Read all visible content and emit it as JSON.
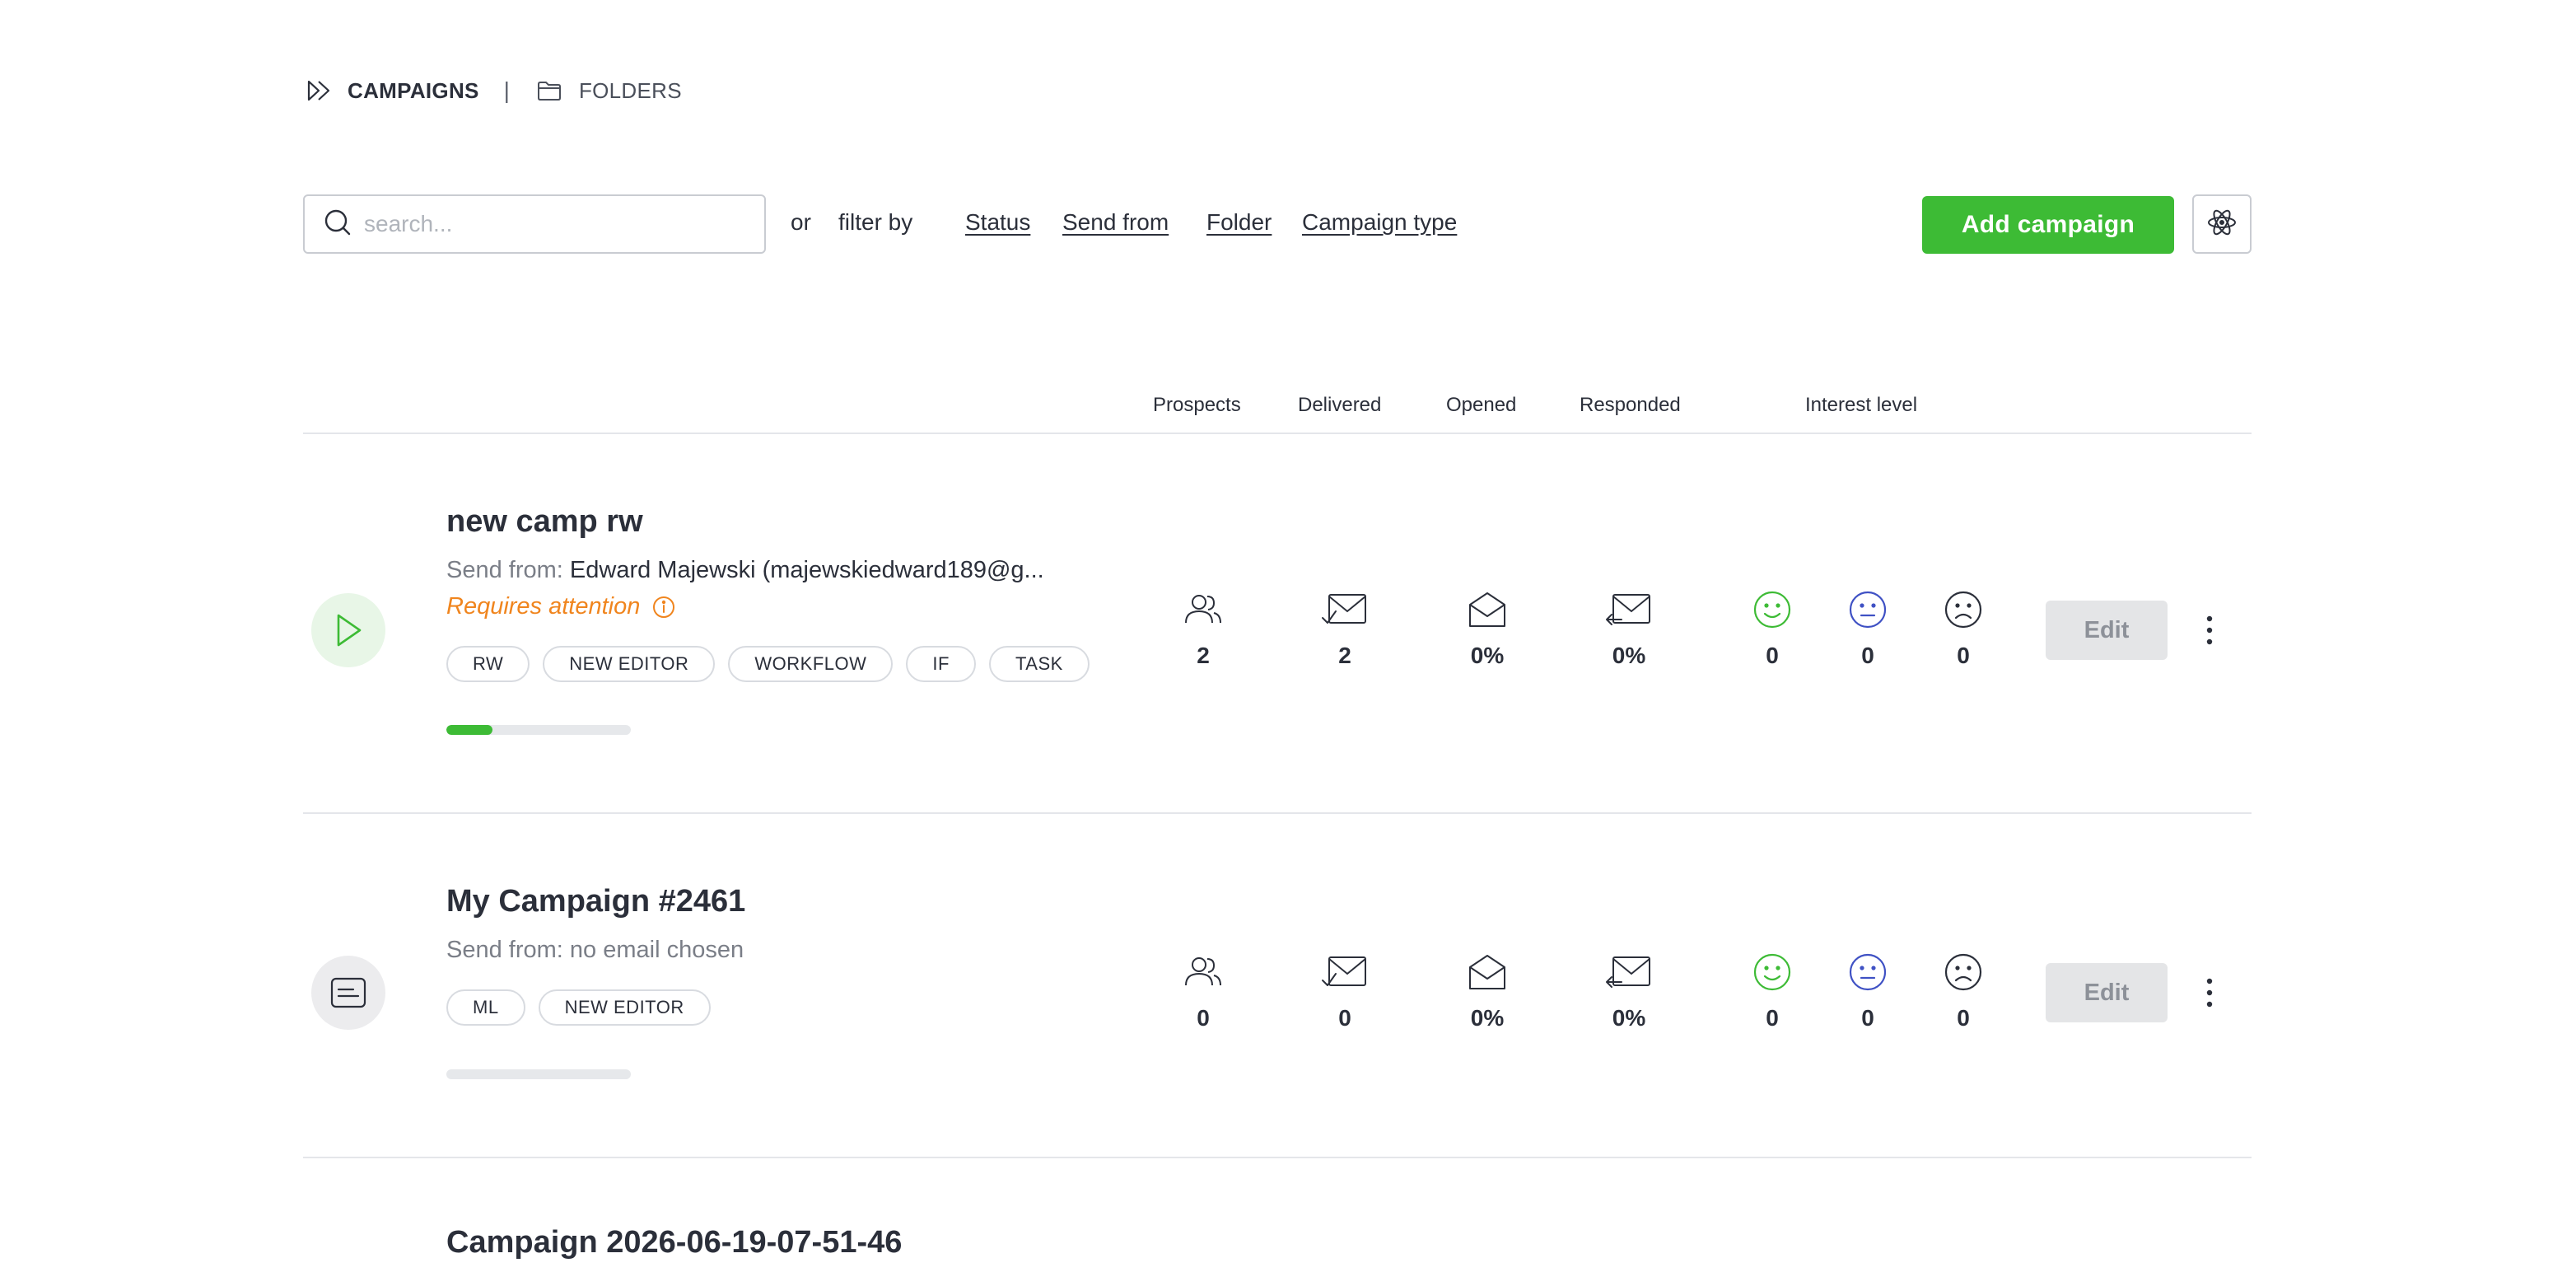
{
  "breadcrumb": {
    "campaigns": "CAMPAIGNS",
    "separator": "|",
    "folders": "FOLDERS"
  },
  "toolbar": {
    "search_placeholder": "search...",
    "or": "or",
    "filter_by": "filter by",
    "filters": [
      "Status",
      "Send from",
      "Folder",
      "Campaign type"
    ],
    "add_campaign": "Add campaign"
  },
  "columns": {
    "prospects": "Prospects",
    "delivered": "Delivered",
    "opened": "Opened",
    "responded": "Responded",
    "interest_level": "Interest level"
  },
  "campaigns": [
    {
      "title": "new camp rw",
      "send_from_label": "Send from:",
      "send_from_value": "Edward Majewski (majewskiedward189@g...",
      "attention": "Requires attention",
      "tags": [
        "RW",
        "NEW EDITOR",
        "WORKFLOW",
        "IF",
        "TASK"
      ],
      "progress": 0.25,
      "prospects": "2",
      "delivered": "2",
      "opened": "0%",
      "responded": "0%",
      "interest_positive": "0",
      "interest_neutral": "0",
      "interest_negative": "0",
      "edit": "Edit"
    },
    {
      "title": "My Campaign #2461",
      "send_from_label": "Send from:",
      "send_from_value": "no email chosen",
      "tags": [
        "ML",
        "NEW EDITOR"
      ],
      "progress": 0,
      "prospects": "0",
      "delivered": "0",
      "opened": "0%",
      "responded": "0%",
      "interest_positive": "0",
      "interest_neutral": "0",
      "interest_negative": "0",
      "edit": "Edit"
    },
    {
      "title": "Campaign 2026-06-19-07-51-46"
    }
  ],
  "colors": {
    "accent_green": "#3dbb35",
    "attention_orange": "#f0851e",
    "neutral_blue": "#3f51c4"
  }
}
